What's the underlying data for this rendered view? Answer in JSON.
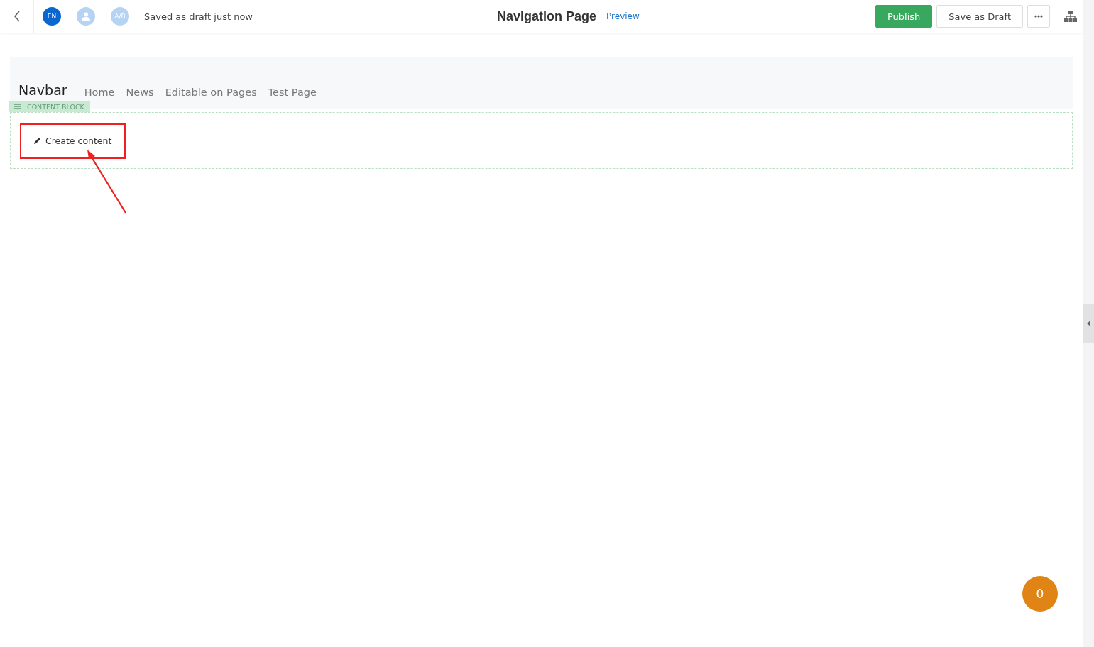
{
  "header": {
    "language": "EN",
    "ab_badge": "A/B",
    "save_status": "Saved as draft just now",
    "title": "Navigation Page",
    "preview_link": "Preview",
    "publish_button": "Publish",
    "draft_button": "Save as Draft"
  },
  "navbar": {
    "brand": "Navbar",
    "links": [
      "Home",
      "News",
      "Editable on Pages",
      "Test Page"
    ]
  },
  "content_block": {
    "label": "CONTENT BLOCK",
    "create_button": "Create content"
  },
  "notification_count": "0"
}
